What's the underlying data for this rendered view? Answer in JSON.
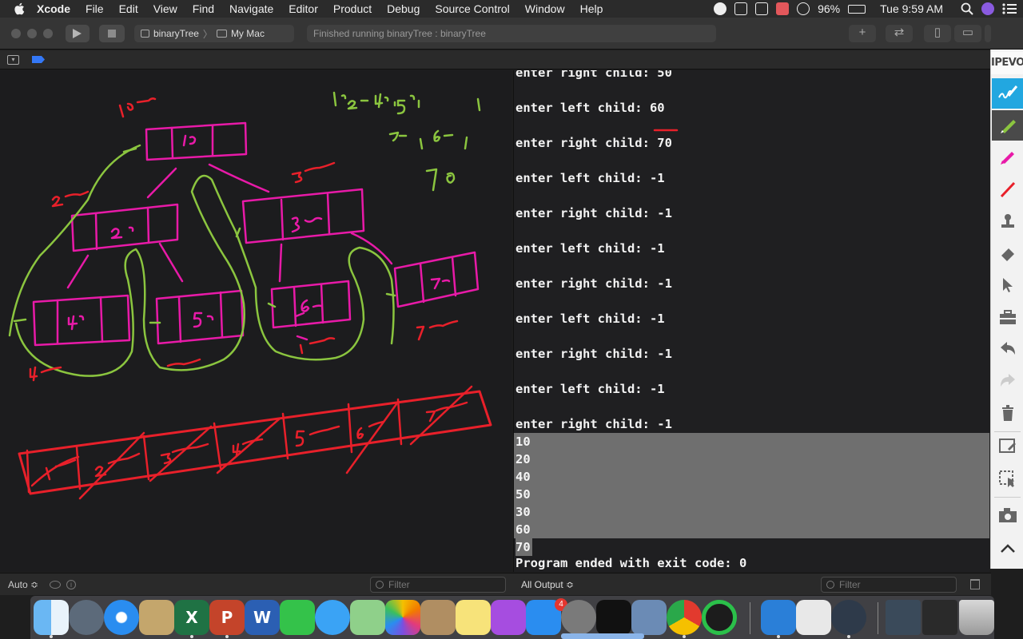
{
  "menubar": {
    "items": [
      "Xcode",
      "File",
      "Edit",
      "View",
      "Find",
      "Navigate",
      "Editor",
      "Product",
      "Debug",
      "Source Control",
      "Window",
      "Help"
    ],
    "battery": "96%",
    "clock": "Tue 9:59 AM"
  },
  "toolbar": {
    "scheme": "binaryTree",
    "destination": "My Mac",
    "status": "Finished running binaryTree : binaryTree"
  },
  "console": {
    "prompts": [
      "enter right child: 50",
      "enter left child: 60",
      "enter right child: 70",
      "enter left child: -1",
      "enter right child: -1",
      "enter left child: -1",
      "enter right child: -1",
      "enter left child: -1",
      "enter right child: -1",
      "enter left child: -1",
      "enter right child: -1"
    ],
    "output": [
      "10",
      "20",
      "40",
      "50",
      "30",
      "60",
      "70"
    ],
    "exit": "Program ended with exit code: 0"
  },
  "debugbar": {
    "auto": "Auto ≎",
    "filter_placeholder": "Filter",
    "all_output": "All Output ≎"
  },
  "ipevo": {
    "logo": "IPEVO",
    "tools": [
      "scribble-pen",
      "pen",
      "highlighter-pink",
      "marker-red",
      "stamp",
      "eraser",
      "pointer",
      "toolbox",
      "undo",
      "redo",
      "clear",
      "capture",
      "capture-region",
      "camera",
      "collapse"
    ]
  },
  "dock": {
    "apps": [
      "finder",
      "launchpad",
      "safari",
      "preview",
      "excel",
      "powerpoint",
      "word",
      "facetime",
      "messages",
      "maps",
      "photos",
      "contacts",
      "notes",
      "podcasts",
      "app-store",
      "system-preferences",
      "apple-tv",
      "image-capture",
      "chrome",
      "activity",
      "xcode",
      "textedit",
      "quicktime",
      "screenshot",
      "terminal-chrome",
      "trash"
    ],
    "app_store_badge": "4",
    "powerpoint_label": "P",
    "word_label": "W",
    "excel_label": "X"
  },
  "colors": {
    "menubar": "#2b2b2b",
    "console_bg": "#1f1f21",
    "output_highlight": "#6f6f6f",
    "drawing_pink": "#e81aa8",
    "drawing_green": "#8bc53f",
    "drawing_red": "#e8202a",
    "ipevo_active": "#22a7e0"
  }
}
